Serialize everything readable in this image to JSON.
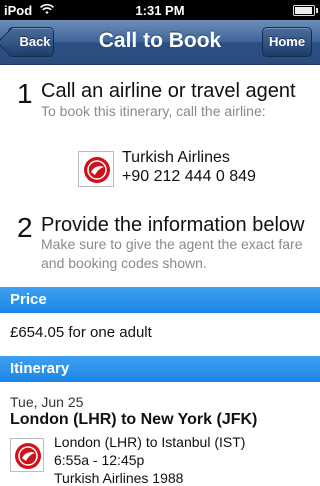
{
  "status_bar": {
    "carrier": "iPod",
    "time": "1:31 PM",
    "wifi_icon": "wifi-icon",
    "battery_icon": "battery-icon"
  },
  "nav": {
    "title": "Call to Book",
    "back_label": "Back",
    "home_label": "Home"
  },
  "step1": {
    "number": "1",
    "heading": "Call an airline or travel agent",
    "description": "To book this itinerary, call the airline:",
    "airline_name": "Turkish Airlines",
    "airline_phone": "+90 212 444 0 849",
    "logo_icon": "turkish-airlines-logo"
  },
  "step2": {
    "number": "2",
    "heading": "Provide the information below",
    "description": "Make sure to give the agent the exact fare and booking codes shown."
  },
  "price": {
    "header": "Price",
    "text": "£654.05 for one adult"
  },
  "itinerary": {
    "header": "Itinerary",
    "date": "Tue, Jun 25",
    "route": "London (LHR) to New York (JFK)",
    "segment": {
      "route": "London (LHR) to Istanbul (IST)",
      "times": "6:55a - 12:45p",
      "flight": "Turkish Airlines 1988"
    }
  },
  "colors": {
    "nav_bar": "#2c4f82",
    "section_header": "#1b86e6",
    "airline_red": "#d0101a"
  }
}
